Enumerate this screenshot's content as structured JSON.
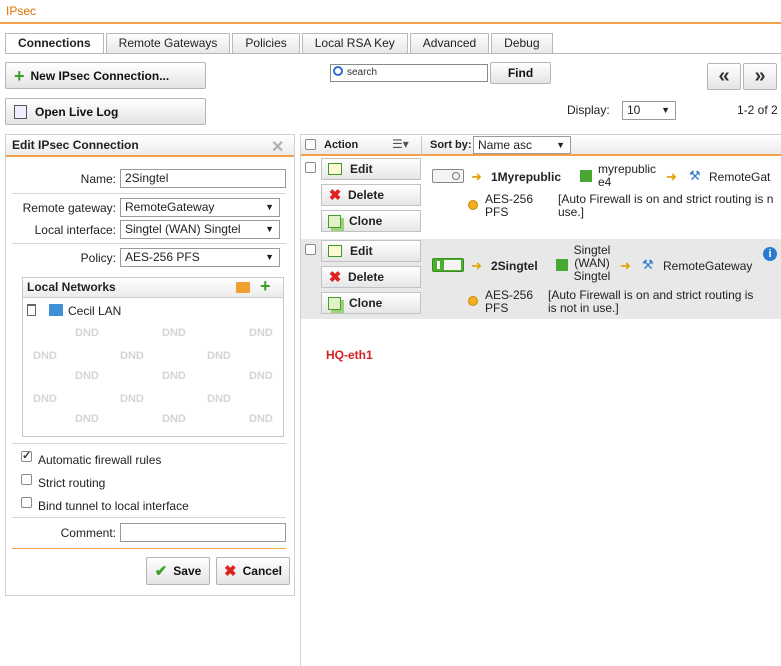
{
  "page": {
    "title": "IPsec"
  },
  "tabs": [
    {
      "label": "Connections"
    },
    {
      "label": "Remote Gateways"
    },
    {
      "label": "Policies"
    },
    {
      "label": "Local RSA Key"
    },
    {
      "label": "Advanced"
    },
    {
      "label": "Debug"
    }
  ],
  "toolbar": {
    "new_connection": "New IPsec Connection...",
    "open_live_log": "Open Live Log",
    "search_placeholder": "search",
    "find": "Find",
    "prev": "«",
    "next": "»",
    "display_label": "Display:",
    "display_value": "10",
    "range": "1-2 of 2"
  },
  "edit_panel": {
    "title": "Edit IPsec Connection",
    "name_label": "Name:",
    "name_value": "2Singtel",
    "remote_gateway_label": "Remote gateway:",
    "remote_gateway_value": "RemoteGateway",
    "local_interface_label": "Local interface:",
    "local_interface_value": "Singtel (WAN) Singtel",
    "policy_label": "Policy:",
    "policy_value": "AES-256 PFS",
    "local_networks_title": "Local Networks",
    "local_network_item": "Cecil LAN",
    "dnd": "DND",
    "auto_fw_label": "Automatic firewall rules",
    "strict_routing_label": "Strict routing",
    "bind_tunnel_label": "Bind tunnel to local interface",
    "comment_label": "Comment:",
    "comment_value": "",
    "save": "Save",
    "cancel": "Cancel"
  },
  "list": {
    "action_header": "Action",
    "sort_by_label": "Sort by:",
    "sort_by_value": "Name asc",
    "edit": "Edit",
    "delete": "Delete",
    "clone": "Clone",
    "rows": [
      {
        "name": "1Myrepublic",
        "interface_line1": "myrepublic",
        "interface_line2": "e4",
        "gateway": "RemoteGat",
        "policy_line1": "AES-256",
        "policy_line2": "PFS",
        "note_line1": "[Auto Firewall is on and strict routing is n",
        "note_line2": "use.]",
        "enabled": false
      },
      {
        "name": "2Singtel",
        "interface_line1": "Singtel",
        "interface_line2": "(WAN)",
        "interface_line3": "Singtel",
        "gateway": "RemoteGateway",
        "policy_line1": "AES-256",
        "policy_line2": "PFS",
        "note_line1": "[Auto Firewall is on and strict routing is",
        "note_line2": "is not in use.]",
        "enabled": true
      }
    ],
    "annotation": "HQ-eth1"
  },
  "colors": {
    "accent": "#f2a24c",
    "title": "#e07000",
    "annotation": "#d42020",
    "toggle_on": "#4cae2e"
  }
}
